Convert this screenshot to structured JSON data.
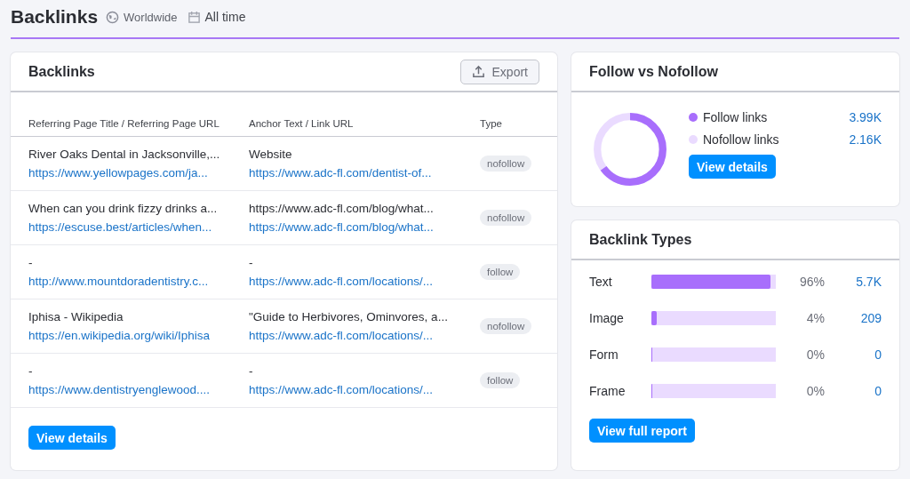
{
  "header": {
    "title": "Backlinks",
    "region": "Worldwide",
    "period": "All time"
  },
  "backlinks": {
    "title": "Backlinks",
    "export_label": "Export",
    "columns": [
      "Referring Page Title / Referring Page URL",
      "Anchor Text / Link URL",
      "Type"
    ],
    "rows": [
      {
        "title": "River Oaks Dental in Jacksonville,...",
        "source_url": "https://www.yellowpages.com/ja...",
        "anchor": "Website",
        "link_url": "https://www.adc-fl.com/dentist-of...",
        "type": "nofollow"
      },
      {
        "title": "When can you drink fizzy drinks a...",
        "source_url": "https://escuse.best/articles/when...",
        "anchor": "https://www.adc-fl.com/blog/what...",
        "link_url": "https://www.adc-fl.com/blog/what...",
        "type": "nofollow"
      },
      {
        "title": "-",
        "source_url": "http://www.mountdoradentistry.c...",
        "anchor": "-",
        "link_url": "https://www.adc-fl.com/locations/...",
        "type": "follow"
      },
      {
        "title": "Iphisa - Wikipedia",
        "source_url": "https://en.wikipedia.org/wiki/Iphisa",
        "anchor": "\"Guide to Herbivores, Ominvores, a...",
        "link_url": "https://www.adc-fl.com/locations/...",
        "type": "nofollow"
      },
      {
        "title": "-",
        "source_url": "https://www.dentistryenglewood....",
        "anchor": "-",
        "link_url": "https://www.adc-fl.com/locations/...",
        "type": "follow"
      }
    ],
    "button": "View details"
  },
  "follow_vs_nofollow": {
    "title": "Follow vs Nofollow",
    "level": 0.65,
    "legend": [
      {
        "label": "Follow links",
        "value": "3.99K",
        "color": "#a86efc"
      },
      {
        "label": "Nofollow links",
        "value": "2.16K",
        "color": "#eadbff"
      }
    ],
    "button": "View details"
  },
  "backlink_types": {
    "title": "Backlink Types",
    "rows": [
      {
        "label": "Text",
        "level": 0.96,
        "percent": "96%",
        "count": "5.7K"
      },
      {
        "label": "Image",
        "level": 0.04,
        "percent": "4%",
        "count": "209"
      },
      {
        "label": "Form",
        "level": 0,
        "percent": "0%",
        "count": "0"
      },
      {
        "label": "Frame",
        "level": 0,
        "percent": "0%",
        "count": "0"
      }
    ],
    "button": "View full report"
  }
}
